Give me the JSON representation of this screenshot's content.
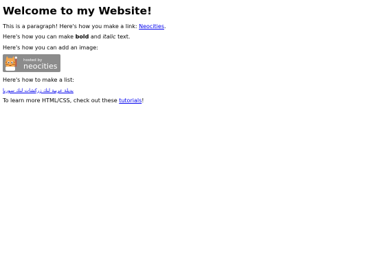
{
  "heading": "Welcome to my Website!",
  "p1": {
    "text": "This is a paragraph! Here's how you make a link: ",
    "link_label": "Neocities",
    "after": "."
  },
  "p2": {
    "before": "Here's how you can make ",
    "bold": "bold",
    "middle": " and ",
    "italic": "italic",
    "after": " text."
  },
  "p3": {
    "text": "Here's how you can add an image:"
  },
  "badge": {
    "line1": "hosted by",
    "line2": "neocities",
    "bg_color": "#8c8c8c",
    "text_color": "#ffffff"
  },
  "p4": {
    "text": "Here's how to make a list:"
  },
  "list_links": {
    "text": "بديلة عربية لنك زركشات لنك سوريا"
  },
  "p6": {
    "before": "To learn more HTML/CSS, check out these ",
    "link_label": "tutorials",
    "after": "!"
  }
}
